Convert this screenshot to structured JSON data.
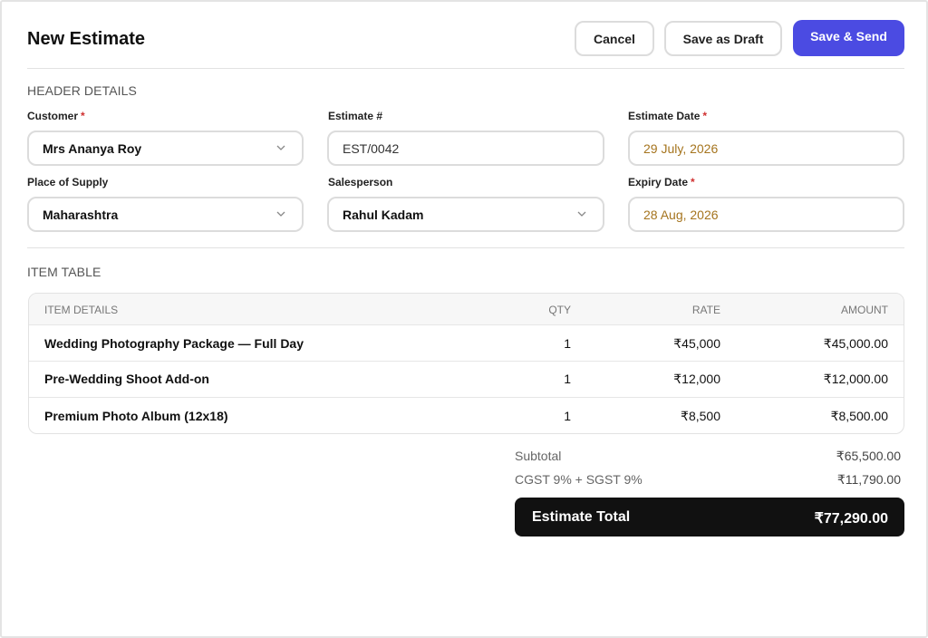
{
  "page": {
    "title": "New Estimate"
  },
  "actions": {
    "cancel": "Cancel",
    "save_draft": "Save as Draft",
    "save_send": "Save & Send"
  },
  "header_details": {
    "section_title": "HEADER DETAILS",
    "customer": {
      "label": "Customer",
      "value": "Mrs Ananya Roy",
      "required": "*"
    },
    "estimate_number": {
      "label": "Estimate #",
      "value": "EST/0042"
    },
    "estimate_date": {
      "label": "Estimate Date",
      "value": "29 July, 2026",
      "required": "*"
    },
    "place_of_supply": {
      "label": "Place of Supply",
      "value": "Maharashtra"
    },
    "salesperson": {
      "label": "Salesperson",
      "value": "Rahul Kadam"
    },
    "expiry_date": {
      "label": "Expiry Date",
      "value": "28 Aug, 2026",
      "required": "*"
    }
  },
  "item_table": {
    "section_title": "ITEM TABLE",
    "columns": [
      "ITEM DETAILS",
      "QTY",
      "RATE",
      "AMOUNT"
    ],
    "rows": [
      {
        "item": "Wedding Photography Package — Full Day",
        "qty": "1",
        "rate": "₹45,000",
        "amount": "₹45,000.00"
      },
      {
        "item": "Pre-Wedding Shoot Add-on",
        "qty": "1",
        "rate": "₹12,000",
        "amount": "₹12,000.00"
      },
      {
        "item": "Premium Photo Album (12x18)",
        "qty": "1",
        "rate": "₹8,500",
        "amount": "₹8,500.00"
      }
    ]
  },
  "summary": {
    "subtotal_label": "Subtotal",
    "subtotal_value": "₹65,500.00",
    "tax_label": "CGST 9% + SGST 9%",
    "tax_value": "₹11,790.00",
    "total_label": "Estimate Total",
    "total_value": "₹77,290.00"
  },
  "colors": {
    "primary": "#4b4be2",
    "total_bg": "#111111",
    "date_text": "#a5741e",
    "required": "#d03030"
  },
  "icons": {
    "select_chevron": "chevron-down-icon"
  }
}
